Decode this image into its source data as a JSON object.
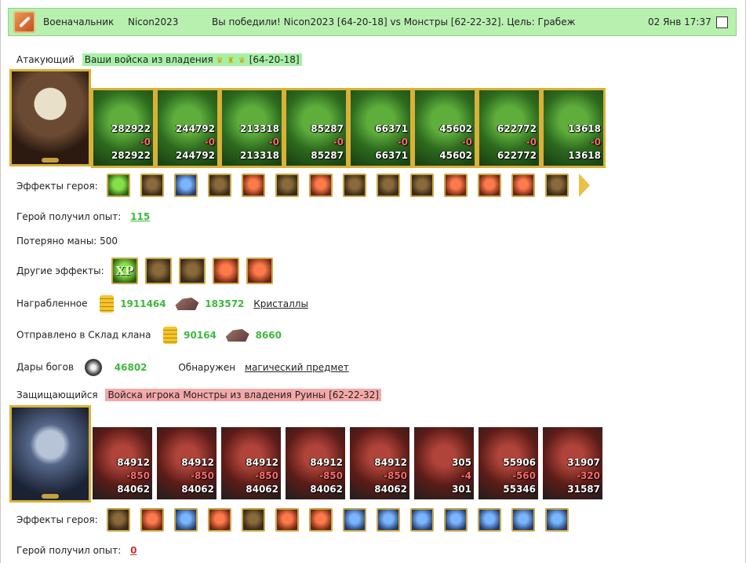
{
  "header": {
    "rank": "Военачальник",
    "player": "Nicon2023",
    "result": "Вы победили! Nicon2023 [64-20-18] vs Монстры [62-22-32]. Цель: Грабеж",
    "time": "02 Янв 17:37"
  },
  "attacker": {
    "label": "Атакующий",
    "army_text": "Ваши войска из владения",
    "crowns": "♛ ♜ ♛",
    "coords": "[64-20-18]",
    "units": [
      {
        "n1": "282922",
        "n2": "-0",
        "n3": "282922"
      },
      {
        "n1": "244792",
        "n2": "-0",
        "n3": "244792"
      },
      {
        "n1": "213318",
        "n2": "-0",
        "n3": "213318"
      },
      {
        "n1": "85287",
        "n2": "-0",
        "n3": "85287"
      },
      {
        "n1": "66371",
        "n2": "-0",
        "n3": "66371"
      },
      {
        "n1": "45602",
        "n2": "-0",
        "n3": "45602"
      },
      {
        "n1": "622772",
        "n2": "-0",
        "n3": "622772"
      },
      {
        "n1": "13618",
        "n2": "-0",
        "n3": "13618"
      }
    ],
    "effects_label": "Эффекты героя:",
    "exp_label": "Герой получил опыт:",
    "exp_value": "115",
    "mana_label": "Потеряно маны: 500",
    "other_effects_label": "Другие эффекты:",
    "xp_icon_text": "XP",
    "loot_label": "Награбленное",
    "loot_gold": "1911464",
    "loot_crystals": "183572",
    "loot_crystals_link": "Кристаллы",
    "clan_label": "Отправлено в Склад клана",
    "clan_gold": "90164",
    "clan_crystals": "8660",
    "gifts_label": "Дары богов",
    "gifts_value": "46802",
    "found_label": "Обнаружен",
    "found_link": "магический предмет"
  },
  "defender": {
    "label": "Защищающийся",
    "army_text": "Войска игрока Монстры из владения Руины [62-22-32]",
    "units": [
      {
        "n1": "84912",
        "n2": "-850",
        "n3": "84062"
      },
      {
        "n1": "84912",
        "n2": "-850",
        "n3": "84062"
      },
      {
        "n1": "84912",
        "n2": "-850",
        "n3": "84062"
      },
      {
        "n1": "84912",
        "n2": "-850",
        "n3": "84062"
      },
      {
        "n1": "84912",
        "n2": "-850",
        "n3": "84062"
      },
      {
        "n1": "305",
        "n2": "-4",
        "n3": "301"
      },
      {
        "n1": "55906",
        "n2": "-560",
        "n3": "55346"
      },
      {
        "n1": "31907",
        "n2": "-320",
        "n3": "31587"
      }
    ],
    "effects_label": "Эффекты героя:",
    "exp_label": "Герой получил опыт:",
    "exp_value": "0"
  }
}
